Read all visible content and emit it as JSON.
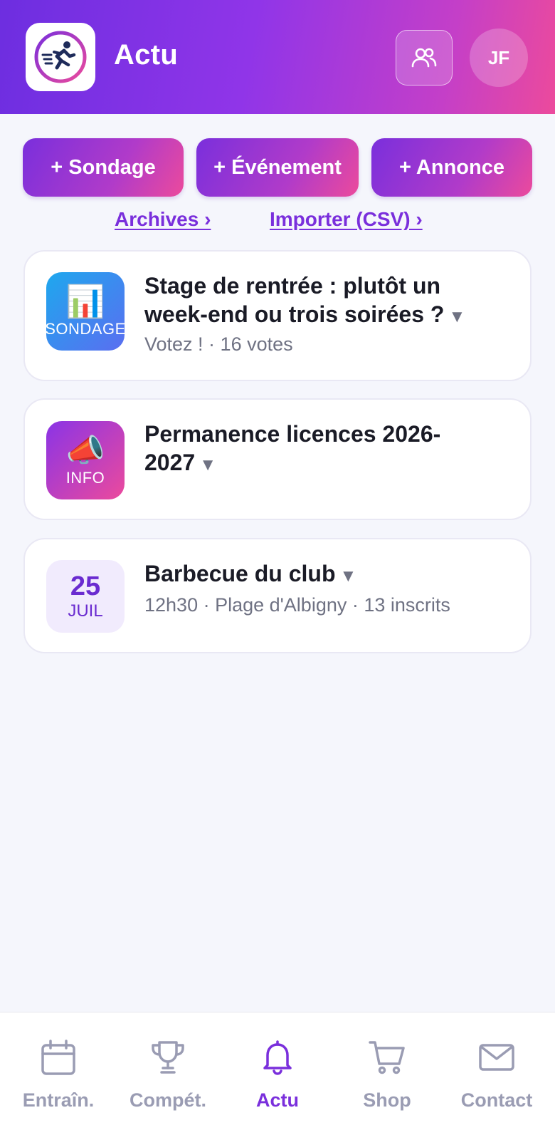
{
  "header": {
    "title": "Actu",
    "avatar_initials": "JF"
  },
  "actions": {
    "poll_label": "+ Sondage",
    "event_label": "+ Événement",
    "announce_label": "+ Annonce"
  },
  "links": {
    "archives": "Archives ›",
    "import_csv": "Importer (CSV) ›"
  },
  "feed": [
    {
      "type": "poll",
      "tile_emoji": "📊",
      "tile_label": "SONDAGE",
      "title": "Stage de rentrée : plutôt un week-end ou trois soirées ?",
      "subtitle": "Votez ! · 16 votes"
    },
    {
      "type": "info",
      "tile_emoji": "📣",
      "tile_label": "INFO",
      "title": "Permanence licences 2026-2027"
    },
    {
      "type": "event",
      "date_day": "25",
      "date_month": "JUIL",
      "title": "Barbecue du club",
      "subtitle": "12h30 · Plage d'Albigny · 13 inscrits"
    }
  ],
  "nav": {
    "items": [
      {
        "label": "Entraîn.",
        "icon": "calendar-icon"
      },
      {
        "label": "Compét.",
        "icon": "trophy-icon"
      },
      {
        "label": "Actu",
        "icon": "bell-icon"
      },
      {
        "label": "Shop",
        "icon": "cart-icon"
      },
      {
        "label": "Contact",
        "icon": "mail-icon"
      }
    ],
    "active": "Actu"
  },
  "colors": {
    "brand_purple": "#7a2fdc",
    "brand_pink": "#ec4a9c",
    "nav_inactive": "#9a9cb3"
  }
}
